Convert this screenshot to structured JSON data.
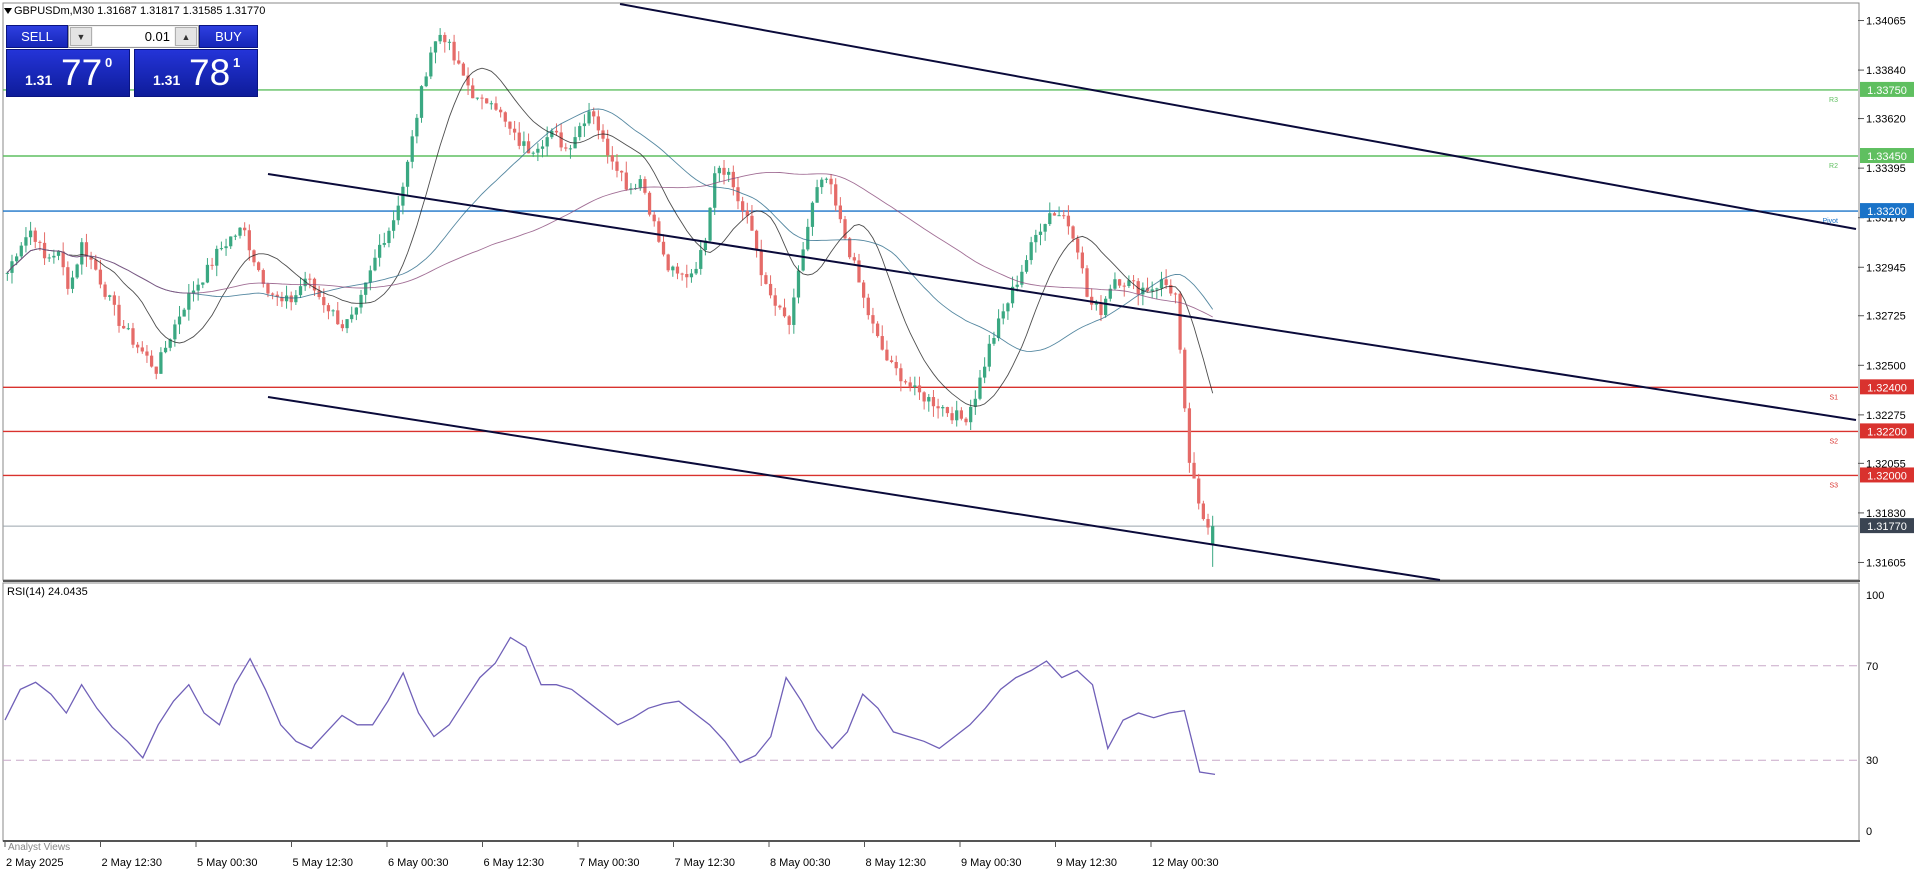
{
  "header": {
    "symbol_line": "GBPUSDm,M30  1.31687 1.31817 1.31585 1.31770"
  },
  "trade_panel": {
    "sell_label": "SELL",
    "buy_label": "BUY",
    "lot_value": "0.01",
    "sell_price": {
      "prefix": "1.31",
      "big": "77",
      "sup": "0"
    },
    "buy_price": {
      "prefix": "1.31",
      "big": "78",
      "sup": "1"
    }
  },
  "price_axis": {
    "ticks": [
      "1.34065",
      "1.33840",
      "1.33620",
      "1.33395",
      "1.33170",
      "1.32945",
      "1.32725",
      "1.32500",
      "1.32275",
      "1.32055",
      "1.31830",
      "1.31605"
    ],
    "tick_values": [
      1.34065,
      1.3384,
      1.3362,
      1.33395,
      1.3317,
      1.32945,
      1.32725,
      1.325,
      1.32275,
      1.32055,
      1.3183,
      1.31605
    ]
  },
  "levels": [
    {
      "label": "1.33750",
      "tag": "R3",
      "value": 1.3375,
      "color": "#5fbf60"
    },
    {
      "label": "1.33450",
      "tag": "R2",
      "value": 1.3345,
      "color": "#5fbf60"
    },
    {
      "label": "1.33200",
      "tag": "Pivot",
      "value": 1.332,
      "color": "#1a73c8"
    },
    {
      "label": "1.32400",
      "tag": "S1",
      "value": 1.324,
      "color": "#d9322e"
    },
    {
      "label": "1.32200",
      "tag": "S2",
      "value": 1.322,
      "color": "#d9322e"
    },
    {
      "label": "1.32000",
      "tag": "S3",
      "value": 1.32,
      "color": "#d9322e"
    }
  ],
  "current_price": {
    "label": "1.31770",
    "value": 1.3177,
    "color": "#3a4452"
  },
  "time_axis": {
    "labels": [
      "2 May 2025",
      "2 May 12:30",
      "5 May 00:30",
      "5 May 12:30",
      "6 May 00:30",
      "6 May 12:30",
      "7 May 00:30",
      "7 May 12:30",
      "8 May 00:30",
      "8 May 12:30",
      "9 May 00:30",
      "9 May 12:30",
      "12 May 00:30"
    ]
  },
  "rsi": {
    "label": "RSI(14) 24.0435",
    "ticks": [
      "100",
      "70",
      "30",
      "0"
    ],
    "tick_values": [
      100,
      70,
      30,
      0
    ]
  },
  "chart_data": {
    "type": "candlestick",
    "symbol": "GBPUSDm",
    "timeframe": "M30",
    "open": 1.31687,
    "high": 1.31817,
    "low": 1.31585,
    "close": 1.3177,
    "ylim": [
      1.3153,
      1.3414
    ],
    "close_path": [
      1.3292,
      1.3305,
      1.3312,
      1.3298,
      1.3302,
      1.3285,
      1.3305,
      1.3295,
      1.3282,
      1.327,
      1.3262,
      1.3255,
      1.3248,
      1.3262,
      1.3275,
      1.3285,
      1.3292,
      1.3302,
      1.3308,
      1.3312,
      1.3296,
      1.3285,
      1.3278,
      1.328,
      1.329,
      1.3282,
      1.3275,
      1.3268,
      1.3272,
      1.3288,
      1.3305,
      1.3315,
      1.3335,
      1.3365,
      1.3392,
      1.3402,
      1.3388,
      1.3378,
      1.3368,
      1.3372,
      1.336,
      1.3352,
      1.3348,
      1.3352,
      1.3355,
      1.3348,
      1.3358,
      1.3368,
      1.335,
      1.3342,
      1.333,
      1.3335,
      1.3315,
      1.3295,
      1.329,
      1.3292,
      1.3302,
      1.3342,
      1.3338,
      1.3322,
      1.331,
      1.3285,
      1.3275,
      1.3268,
      1.3302,
      1.3328,
      1.3335,
      1.3315,
      1.3298,
      1.3278,
      1.3262,
      1.325,
      1.3245,
      1.3238,
      1.3235,
      1.3232,
      1.3228,
      1.3225,
      1.3238,
      1.3258,
      1.3272,
      1.3285,
      1.3298,
      1.3312,
      1.332,
      1.3318,
      1.3308,
      1.3278,
      1.3275,
      1.329,
      1.3288,
      1.3285,
      1.3285,
      1.3288,
      1.3282,
      1.321,
      1.3182,
      1.3177
    ],
    "rsi_path": [
      47,
      60,
      63,
      58,
      50,
      62,
      52,
      44,
      38,
      31,
      45,
      55,
      62,
      50,
      45,
      62,
      73,
      60,
      45,
      38,
      35,
      42,
      49,
      45,
      45,
      55,
      67,
      50,
      40,
      45,
      55,
      65,
      71,
      82,
      78,
      62,
      62,
      60,
      55,
      50,
      45,
      48,
      52,
      54,
      55,
      50,
      45,
      38,
      29,
      32,
      40,
      65,
      55,
      43,
      35,
      42,
      58,
      52,
      42,
      40,
      38,
      35,
      40,
      45,
      52,
      60,
      65,
      68,
      72,
      65,
      68,
      62,
      35,
      47,
      50,
      48,
      50,
      51,
      25,
      24
    ],
    "overlays": [
      "moving averages",
      "descending channel trendlines",
      "pivot levels"
    ]
  }
}
